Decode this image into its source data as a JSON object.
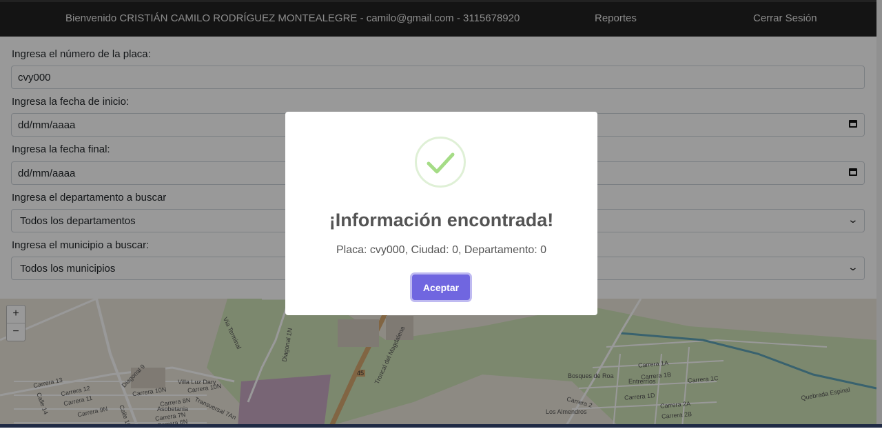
{
  "header": {
    "welcome": "Bienvenido CRISTIÁN CAMILO RODRÍGUEZ MONTEALEGRE - camilo@gmail.com - 3115678920",
    "reports": "Reportes",
    "logout": "Cerrar Sesión"
  },
  "form": {
    "plate_label": "Ingresa el número de la placa:",
    "plate_value": "cvy000",
    "start_label": "Ingresa la fecha de inicio:",
    "start_value": "dd/mm/aaaa",
    "end_label": "Ingresa la fecha final:",
    "end_value": "dd/mm/aaaa",
    "dept_label": "Ingresa el departamento a buscar",
    "dept_value": "Todos los departamentos",
    "muni_label": "Ingresa el municipio a buscar:",
    "muni_value": "Todos los municipios"
  },
  "map": {
    "zoom_in": "+",
    "zoom_out": "−",
    "labels": [
      "Carrera 13",
      "Carrera 12",
      "Carrera 11",
      "Carrera 9N",
      "Calle 14",
      "Calle 10",
      "Diagonal 9",
      "Carrera 10N",
      "Villa Luz Dary",
      "Carrera 10N",
      "Asobetania",
      "Carrera 8N",
      "Carrera 7N",
      "Carrera 6N",
      "Transversal 7An",
      "Vía Terminal",
      "Diagonal 1N",
      "Troncal del Magdalena",
      "45",
      "Bosques de Roa",
      "Entrerríos",
      "Los Almendros",
      "Carrera 1A",
      "Carrera 1B",
      "Carrera 1C",
      "Carrera 1D",
      "Carrera 2",
      "Carrera 2A",
      "Carrera 2B",
      "Quebrada Espinal"
    ]
  },
  "modal": {
    "title": "¡Información encontrada!",
    "message": "Placa: cvy000, Ciudad: 0, Departamento: 0",
    "ok_label": "Aceptar"
  },
  "colors": {
    "topbar": "#222222",
    "button": "#7066e0",
    "success": "#a5dc86"
  }
}
